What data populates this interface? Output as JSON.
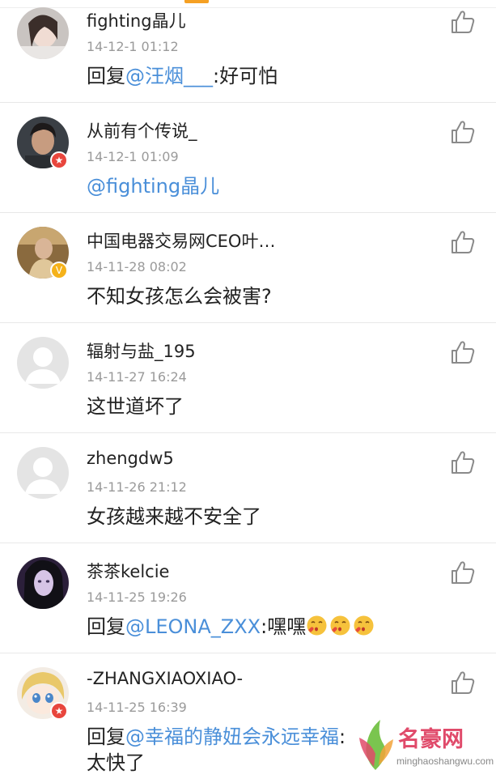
{
  "comments": [
    {
      "name": "fighting晶儿",
      "time": "14-12-1 01:12",
      "prefix": "回复",
      "mention": "@汪烟___",
      "text": ":好可怕",
      "avatar": "photo-girl",
      "badge": ""
    },
    {
      "name": "从前有个传说_",
      "time": "14-12-1 01:09",
      "prefix": "",
      "mention": "@fighting晶儿",
      "text": "",
      "avatar": "photo-man",
      "badge": "red"
    },
    {
      "name": "中国电器交易网CEO叶…",
      "time": "14-11-28 08:02",
      "prefix": "",
      "mention": "",
      "text": "不知女孩怎么会被害?",
      "avatar": "photo-man-desk",
      "badge": "gold"
    },
    {
      "name": "辐射与盐_195",
      "time": "14-11-27 16:24",
      "prefix": "",
      "mention": "",
      "text": "这世道坏了",
      "avatar": "default-avatar",
      "badge": ""
    },
    {
      "name": "zhengdw5",
      "time": "14-11-26 21:12",
      "prefix": "",
      "mention": "",
      "text": "女孩越来越不安全了",
      "avatar": "default-avatar",
      "badge": ""
    },
    {
      "name": "茶茶kelcie",
      "time": "14-11-25 19:26",
      "prefix": "回复",
      "mention": "@LEONA_ZXX",
      "text": ":嘿嘿",
      "avatar": "photo-girl-dark",
      "badge": ""
    },
    {
      "name": "-ZHANGXIAOXIAO-",
      "time": "14-11-25 16:39",
      "prefix": "回复",
      "mention": "@幸福的静妞会永远幸福",
      "text": ":",
      "line2": "太快了",
      "avatar": "anime-avatar",
      "badge": "red"
    }
  ],
  "watermark": {
    "brand": "名豪网",
    "url": "minghaoshangwu.com"
  },
  "colors": {
    "accent": "#f5a023",
    "mention": "#4a8fd9",
    "vip_red": "#e8463d",
    "vip_gold": "#f5b21a"
  }
}
